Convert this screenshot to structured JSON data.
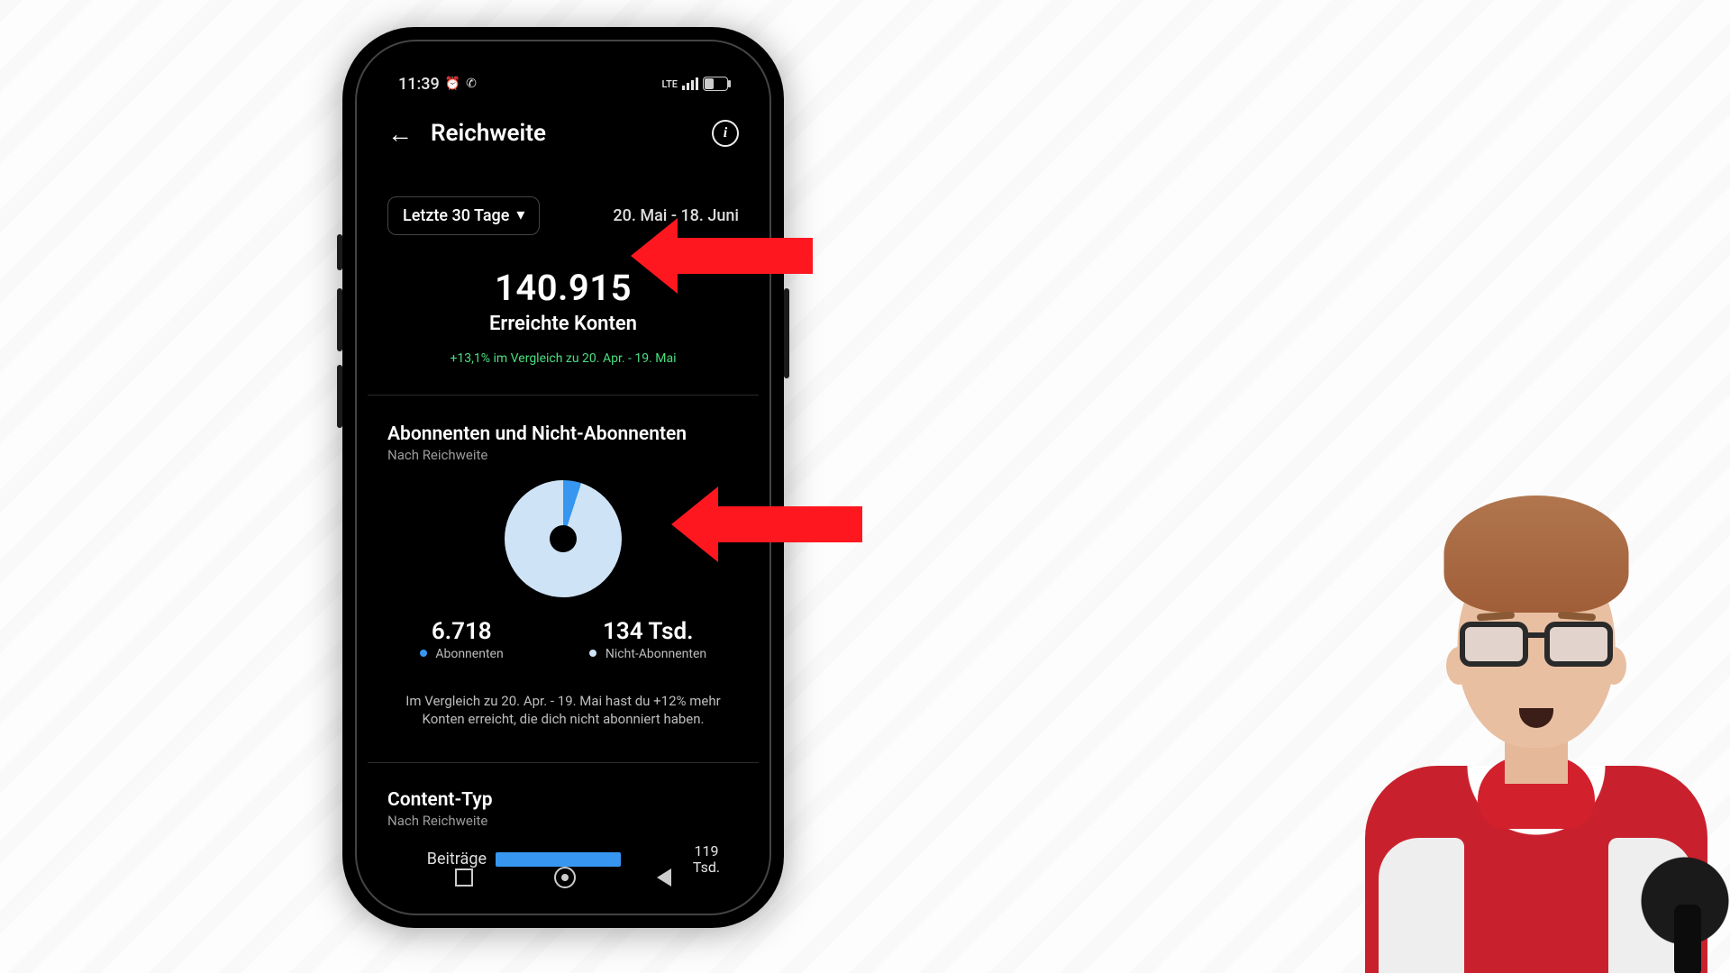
{
  "status": {
    "time": "11:39"
  },
  "title": "Reichweite",
  "range": {
    "pill_label": "Letzte 30 Tage",
    "dates": "20. Mai - 18. Juni"
  },
  "headline": {
    "value": "140.915",
    "label": "Erreichte Konten",
    "delta": "+13,1% im Vergleich zu 20. Apr. - 19. Mai"
  },
  "followers_section": {
    "title": "Abonnenten und Nicht-Abonnenten",
    "subtitle": "Nach Reichweite",
    "followers": {
      "value": "6.718",
      "label": "Abonnenten"
    },
    "non_followers": {
      "value": "134 Tsd.",
      "label": "Nicht-Abonnenten"
    },
    "compare_text": "Im Vergleich zu 20. Apr. - 19. Mai hast du +12% mehr Konten erreicht, die dich nicht abonniert haben."
  },
  "content_section": {
    "title": "Content-Typ",
    "subtitle": "Nach Reichweite",
    "row_label": "Beiträge",
    "row_value_line1": "119",
    "row_value_line2": "Tsd."
  },
  "chart_data": [
    {
      "type": "pie",
      "title": "Abonnenten und Nicht-Abonnenten nach Reichweite",
      "series": [
        {
          "name": "Abonnenten",
          "value": 6718,
          "value_label": "6.718",
          "color": "#3797f0"
        },
        {
          "name": "Nicht-Abonnenten",
          "value": 134000,
          "value_label": "134 Tsd.",
          "color": "#cfe3f6"
        }
      ]
    },
    {
      "type": "bar",
      "title": "Content-Typ nach Reichweite",
      "categories": [
        "Beiträge"
      ],
      "values": [
        119000
      ],
      "value_labels": [
        "119 Tsd."
      ],
      "xlabel": "",
      "ylabel": ""
    }
  ]
}
